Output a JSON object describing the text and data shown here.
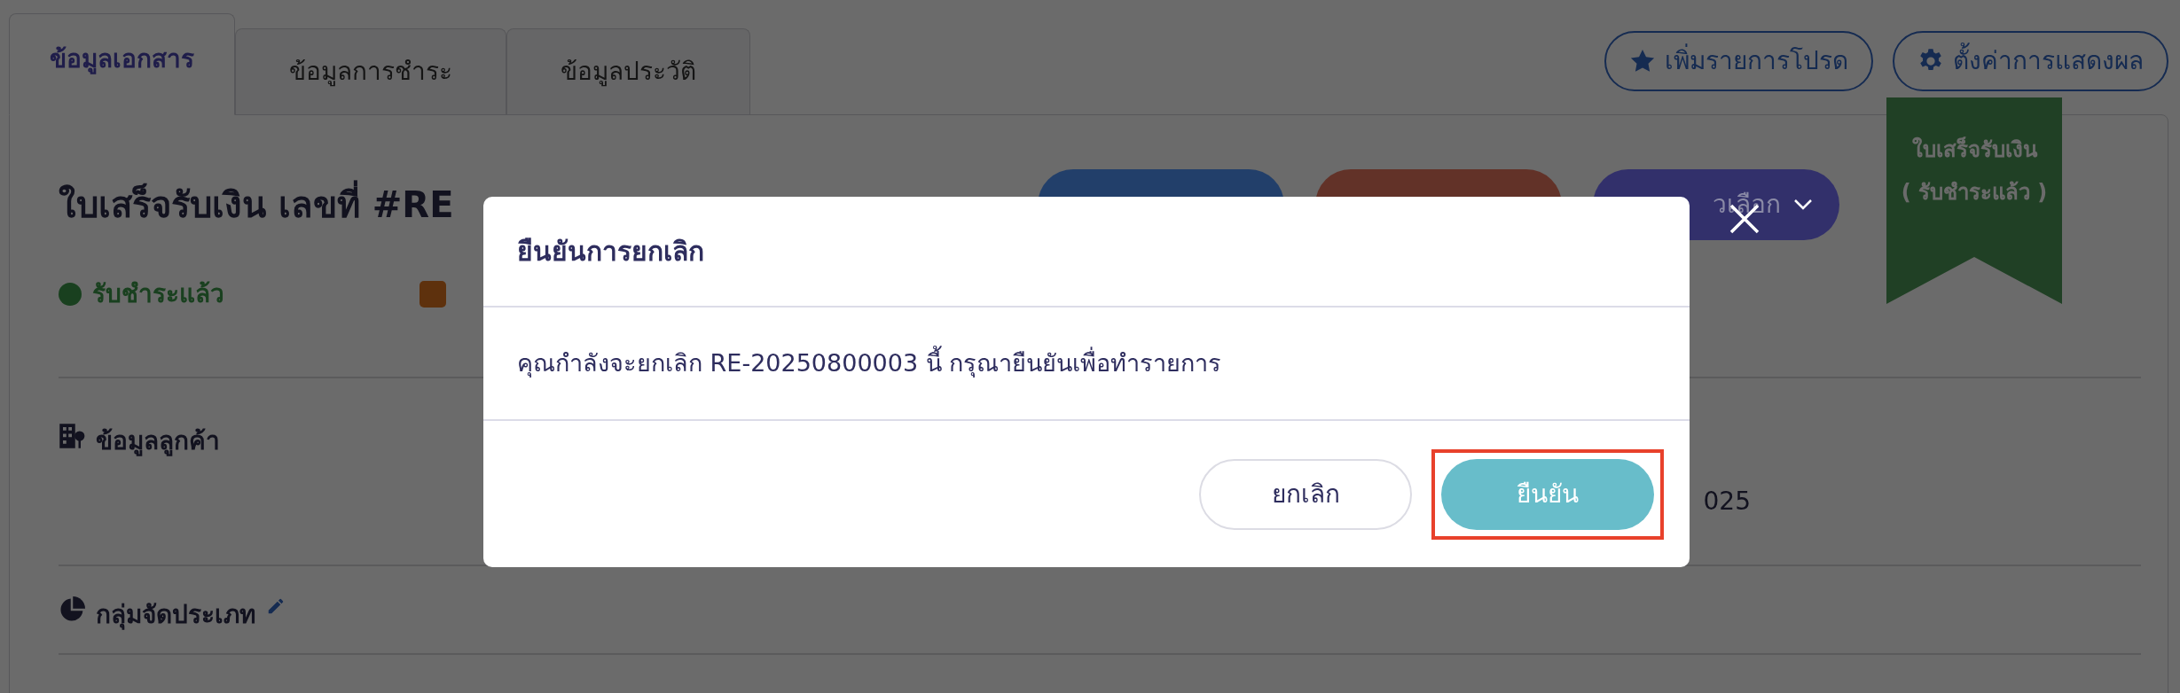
{
  "tabs": [
    {
      "label": "ข้อมูลเอกสาร",
      "selected": true
    },
    {
      "label": "ข้อมูลการชำระ",
      "selected": false
    },
    {
      "label": "ข้อมูลประวัติ",
      "selected": false
    }
  ],
  "toolbar_buttons": [
    {
      "kind": "star",
      "label": "เพิ่มรายการโปรด"
    },
    {
      "kind": "gear",
      "label": "ตั้งค่าการแสดงผล"
    }
  ],
  "ribbon": {
    "lines": [
      "ใบเสร็จรับเงิน",
      "( รับชำระแล้ว )"
    ]
  },
  "document": {
    "title": "ใบเสร็จรับเงิน เลขที่ #RE",
    "status": "รับชำระแล้ว"
  },
  "actions": [
    {
      "color": "#223f6a"
    },
    {
      "color": "#623228"
    },
    {
      "color": "#32306b",
      "label": "วเลือก"
    }
  ],
  "sections": [
    {
      "kind": "customer",
      "title": "ข้อมูลลูกค้า",
      "value": "025"
    },
    {
      "kind": "category",
      "title": "กลุ่มจัดประเภท",
      "editable": true
    }
  ],
  "modal": {
    "title": "ยืนยันการยกเลิก",
    "message": "คุณกำลังจะยกเลิก RE-20250800003 นี้ กรุณายืนยันเพื่อทำรายการ",
    "buttons": [
      {
        "kind": "cancel",
        "label": "ยกเลิก",
        "highlighted": false
      },
      {
        "kind": "confirm",
        "label": "ยืนยัน",
        "highlighted": true
      }
    ]
  }
}
